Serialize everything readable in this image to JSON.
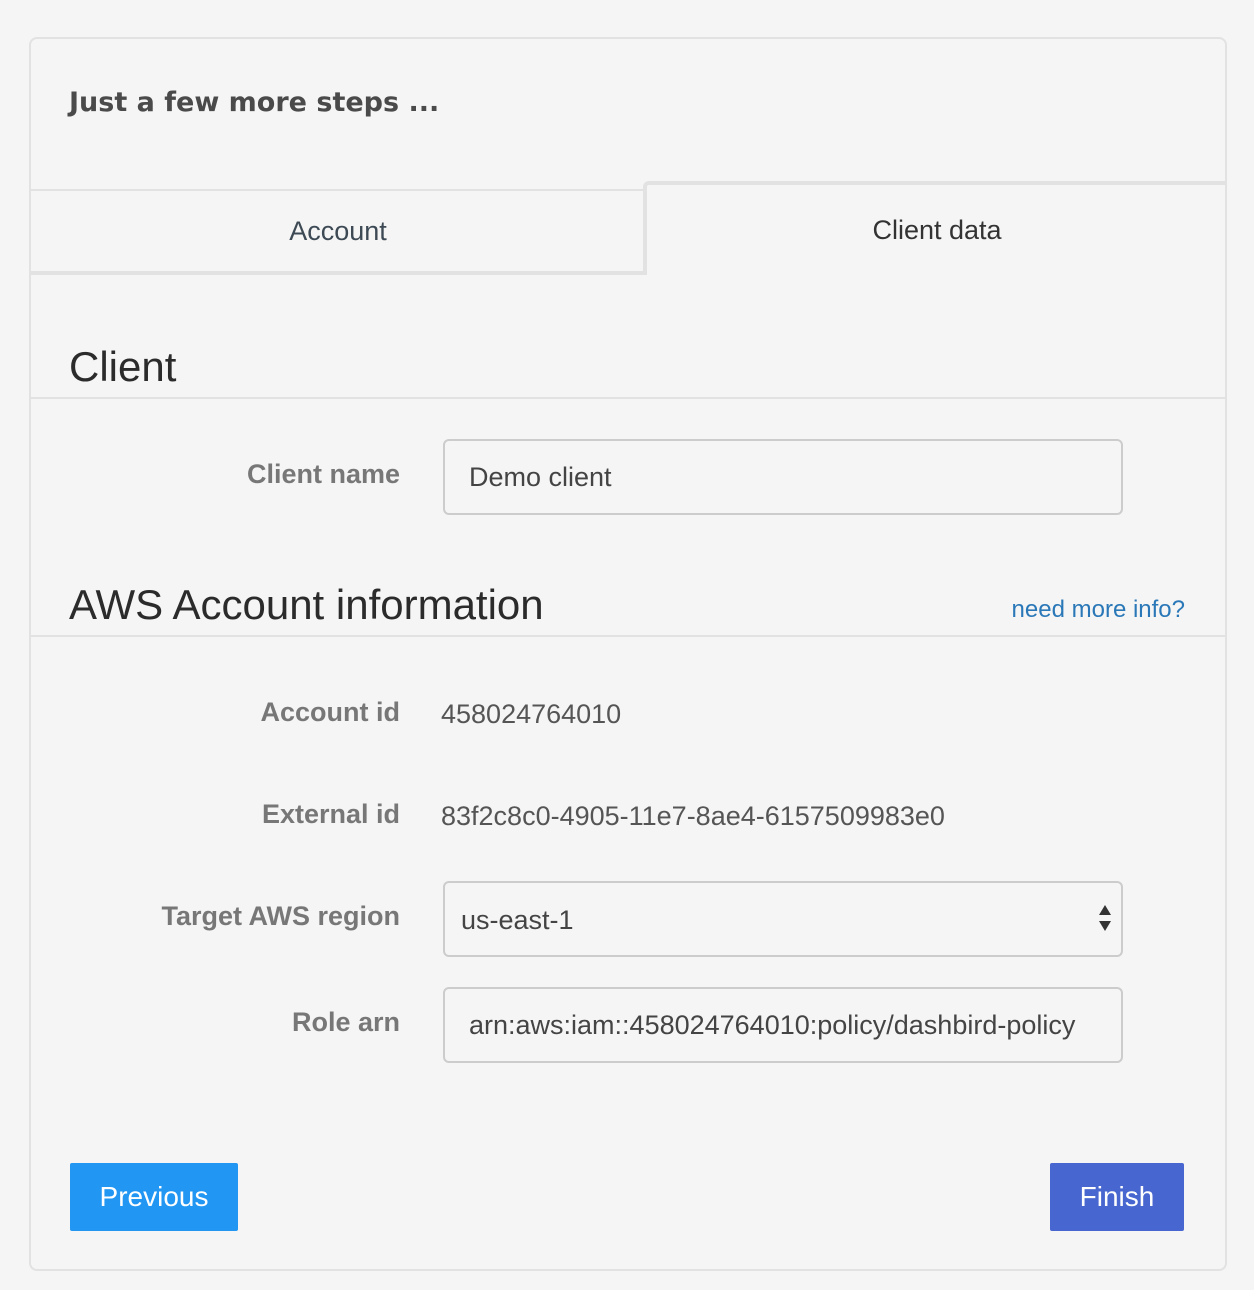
{
  "wizard": {
    "title": "Just a few more steps ..."
  },
  "tabs": [
    {
      "label": "Account",
      "active": false
    },
    {
      "label": "Client data",
      "active": true
    }
  ],
  "client_section": {
    "heading": "Client",
    "client_name_label": "Client name",
    "client_name_value": "Demo client"
  },
  "aws_section": {
    "heading": "AWS Account information",
    "more_info_link": "need more info?",
    "account_id_label": "Account id",
    "account_id_value": "458024764010",
    "external_id_label": "External id",
    "external_id_value": "83f2c8c0-4905-11e7-8ae4-6157509983e0",
    "region_label": "Target AWS region",
    "region_value": "us-east-1",
    "role_arn_label": "Role arn",
    "role_arn_value": "arn:aws:iam::458024764010:policy/dashbird-policy"
  },
  "buttons": {
    "previous": "Previous",
    "finish": "Finish"
  },
  "colors": {
    "primary": "#2196f3",
    "finish": "#4766cf",
    "link": "#2a78b8"
  }
}
